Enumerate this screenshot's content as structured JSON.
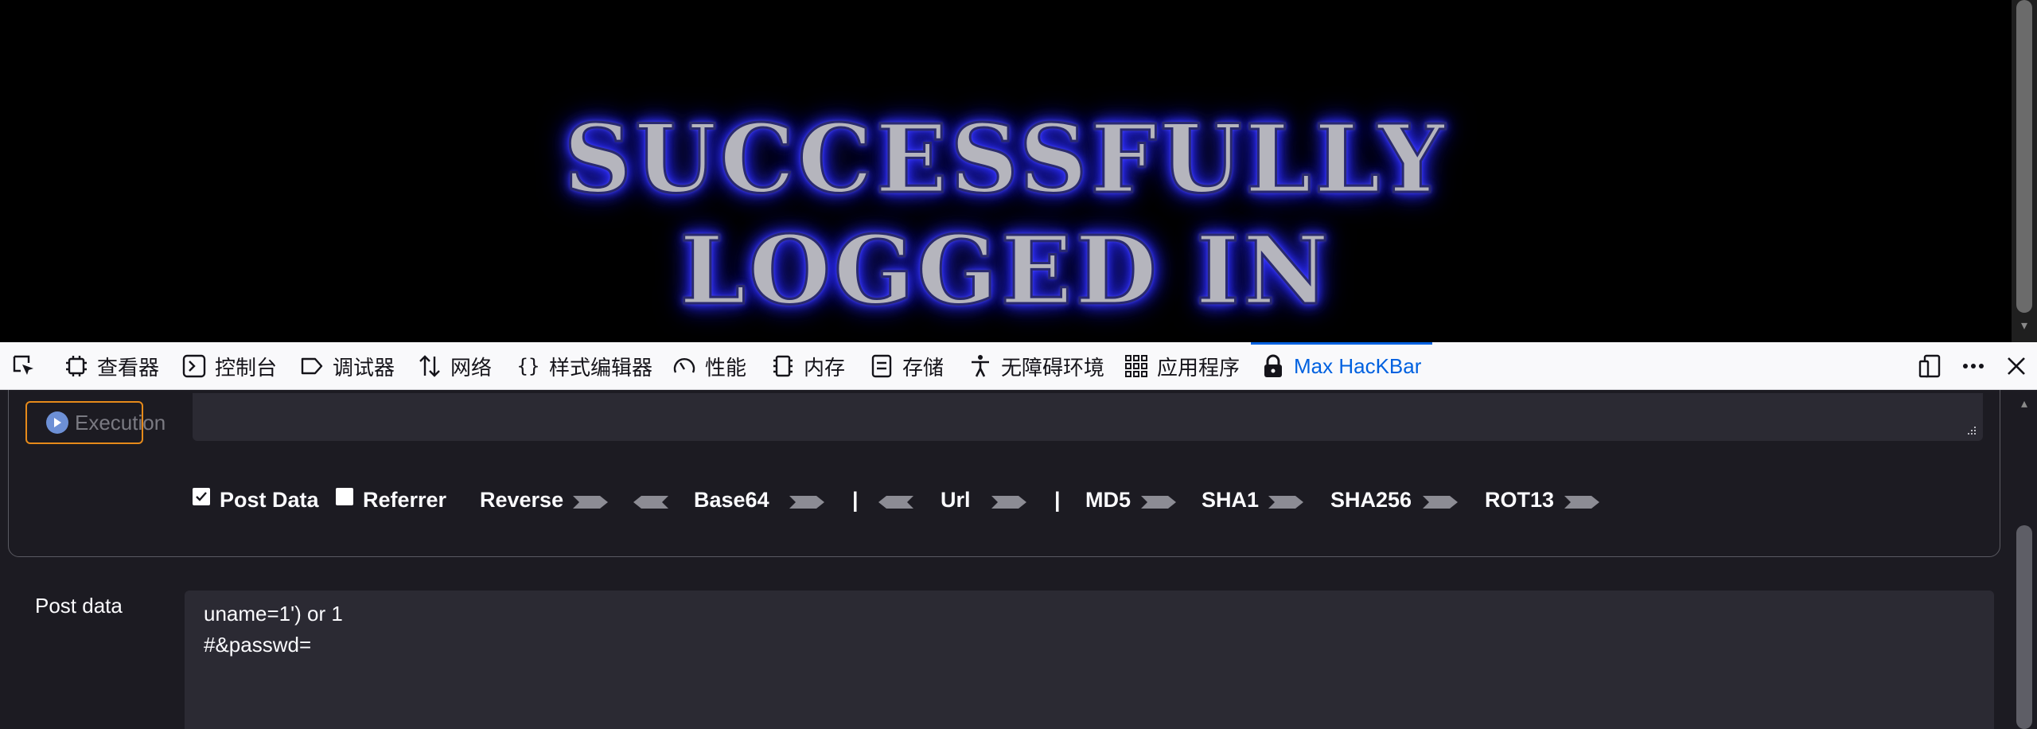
{
  "page": {
    "hero_line_1": "SUCCESSFULLY",
    "hero_line_2": "LOGGED IN"
  },
  "devtools": {
    "tabs": [
      {
        "label": "查看器",
        "icon": "inspector-icon"
      },
      {
        "label": "控制台",
        "icon": "console-icon"
      },
      {
        "label": "调试器",
        "icon": "debugger-icon"
      },
      {
        "label": "网络",
        "icon": "network-icon"
      },
      {
        "label": "样式编辑器",
        "icon": "style-editor-icon"
      },
      {
        "label": "性能",
        "icon": "performance-icon"
      },
      {
        "label": "内存",
        "icon": "memory-icon"
      },
      {
        "label": "存储",
        "icon": "storage-icon"
      },
      {
        "label": "无障碍环境",
        "icon": "accessibility-icon"
      },
      {
        "label": "应用程序",
        "icon": "application-icon"
      },
      {
        "label": "Max HacKBar",
        "icon": "lock-icon",
        "active": true
      }
    ],
    "accent_color": "#0061e0"
  },
  "hackbar": {
    "execution_label": "Execution",
    "options": {
      "post_data": {
        "label": "Post Data",
        "checked": true
      },
      "referrer": {
        "label": "Referrer",
        "checked": false
      },
      "reverse": "Reverse",
      "base64": "Base64",
      "separator": "|",
      "url": "Url",
      "md5": "MD5",
      "sha1": "SHA1",
      "sha256": "SHA256",
      "rot13": "ROT13"
    },
    "post_data_label": "Post data",
    "post_data_lines": [
      "uname=1') or 1",
      "#&passwd="
    ],
    "execution_border_color": "#e68a1a"
  }
}
